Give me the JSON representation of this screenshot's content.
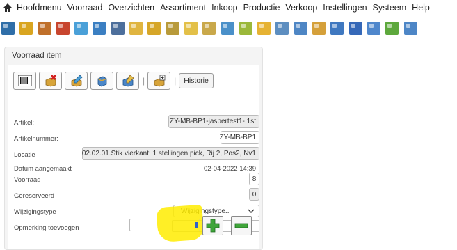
{
  "menu": {
    "items": [
      "Hoofdmenu",
      "Voorraad",
      "Overzichten",
      "Assortiment",
      "Inkoop",
      "Productie",
      "Verkoop",
      "Instellingen",
      "Systeem",
      "Help"
    ],
    "home_icon": "home-icon"
  },
  "toolbar": {
    "icons": [
      {
        "name": "tb-stock-list-icon",
        "color": "#2f6ea8"
      },
      {
        "name": "tb-box-add-icon",
        "color": "#d9a520"
      },
      {
        "name": "tb-users-icon",
        "color": "#c0702a"
      },
      {
        "name": "tb-tools-icon",
        "color": "#c8452e"
      },
      {
        "name": "tb-pencil-icon",
        "color": "#4aa0d8"
      },
      {
        "name": "tb-grid-icon",
        "color": "#3b7fc2"
      },
      {
        "name": "tb-truck-icon",
        "color": "#4d6f9c"
      },
      {
        "name": "tb-edit-icon",
        "color": "#e0b540"
      },
      {
        "name": "tb-box-icon",
        "color": "#d6a628"
      },
      {
        "name": "tb-box-search-icon",
        "color": "#b89a3a"
      },
      {
        "name": "tb-search-icon",
        "color": "#e3c048"
      },
      {
        "name": "tb-zoom-icon",
        "color": "#c9a84a"
      },
      {
        "name": "tb-globe-icon",
        "color": "#4a90c9"
      },
      {
        "name": "tb-cart-icon",
        "color": "#9bb83a"
      },
      {
        "name": "tb-star-icon",
        "color": "#e6b232"
      },
      {
        "name": "tb-pen-icon",
        "color": "#5d8ec0"
      },
      {
        "name": "tb-doc-icon",
        "color": "#4e86c4"
      },
      {
        "name": "tb-gift-icon",
        "color": "#d5a03a"
      },
      {
        "name": "tb-blue-box-icon",
        "color": "#3f78c0"
      },
      {
        "name": "tb-cube-icon",
        "color": "#3568b8"
      },
      {
        "name": "tb-arrow-icon",
        "color": "#4f87cc"
      },
      {
        "name": "tb-check-icon",
        "color": "#5da83c"
      },
      {
        "name": "tb-user-icon",
        "color": "#4d86c6"
      }
    ]
  },
  "panel": {
    "title": "Voorraad item",
    "buttons": {
      "history_label": "Historie",
      "icons": [
        "barcode-icon",
        "delete-icon",
        "edit-icon",
        "move-icon",
        "transfer-icon",
        "add-icon"
      ]
    },
    "fields": {
      "artikel_label": "Artikel:",
      "artikel_value": "ZY-MB-BP1-jaspertest1- 1st",
      "artikelnummer_label": "Artikelnummer:",
      "artikelnummer_value": "ZY-MB-BP1",
      "locatie_label": "Locatie",
      "locatie_value": "02.02.01.Stik vierkant: 1 stellingen pick, Rij 2, Pos2, Nv1",
      "datum_label": "Datum aangemaakt",
      "datum_value": "02-04-2022 14:39",
      "voorraad_label": "Voorraad",
      "voorraad_value": "8",
      "gereserveerd_label": "Gereserveerd",
      "gereserveerd_value": "0",
      "wijzigingstype_label": "Wijzigingstype",
      "wijzigingstype_value": "Wijzigingstype..",
      "opmerking_label": "Opmerking toevoegen",
      "opmerking_value": "",
      "quantity_value": ""
    }
  }
}
